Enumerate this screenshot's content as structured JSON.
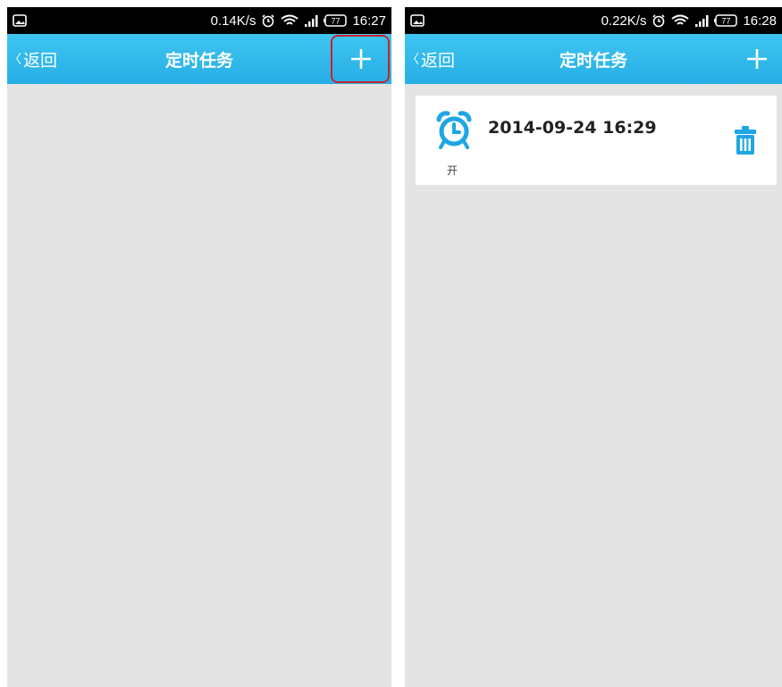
{
  "screens": [
    {
      "status": {
        "speed": "0.14K/s",
        "battery": "77",
        "time": "16:27"
      },
      "header": {
        "back_label": "返回",
        "title": "定时任务"
      }
    },
    {
      "status": {
        "speed": "0.22K/s",
        "battery": "77",
        "time": "16:28"
      },
      "header": {
        "back_label": "返回",
        "title": "定时任务"
      },
      "task": {
        "datetime": "2014-09-24 16:29",
        "state_label": "开"
      }
    }
  ],
  "icons": [
    "image-icon",
    "alarm-icon",
    "wifi-icon",
    "signal-icon",
    "battery-icon",
    "back-chevron-icon",
    "plus-icon",
    "clock-icon",
    "trash-icon"
  ],
  "colors": {
    "appbar": "#2bb3e8",
    "accent": "#1ea6e4",
    "highlight": "#c8242c",
    "background": "#e4e4e4"
  }
}
